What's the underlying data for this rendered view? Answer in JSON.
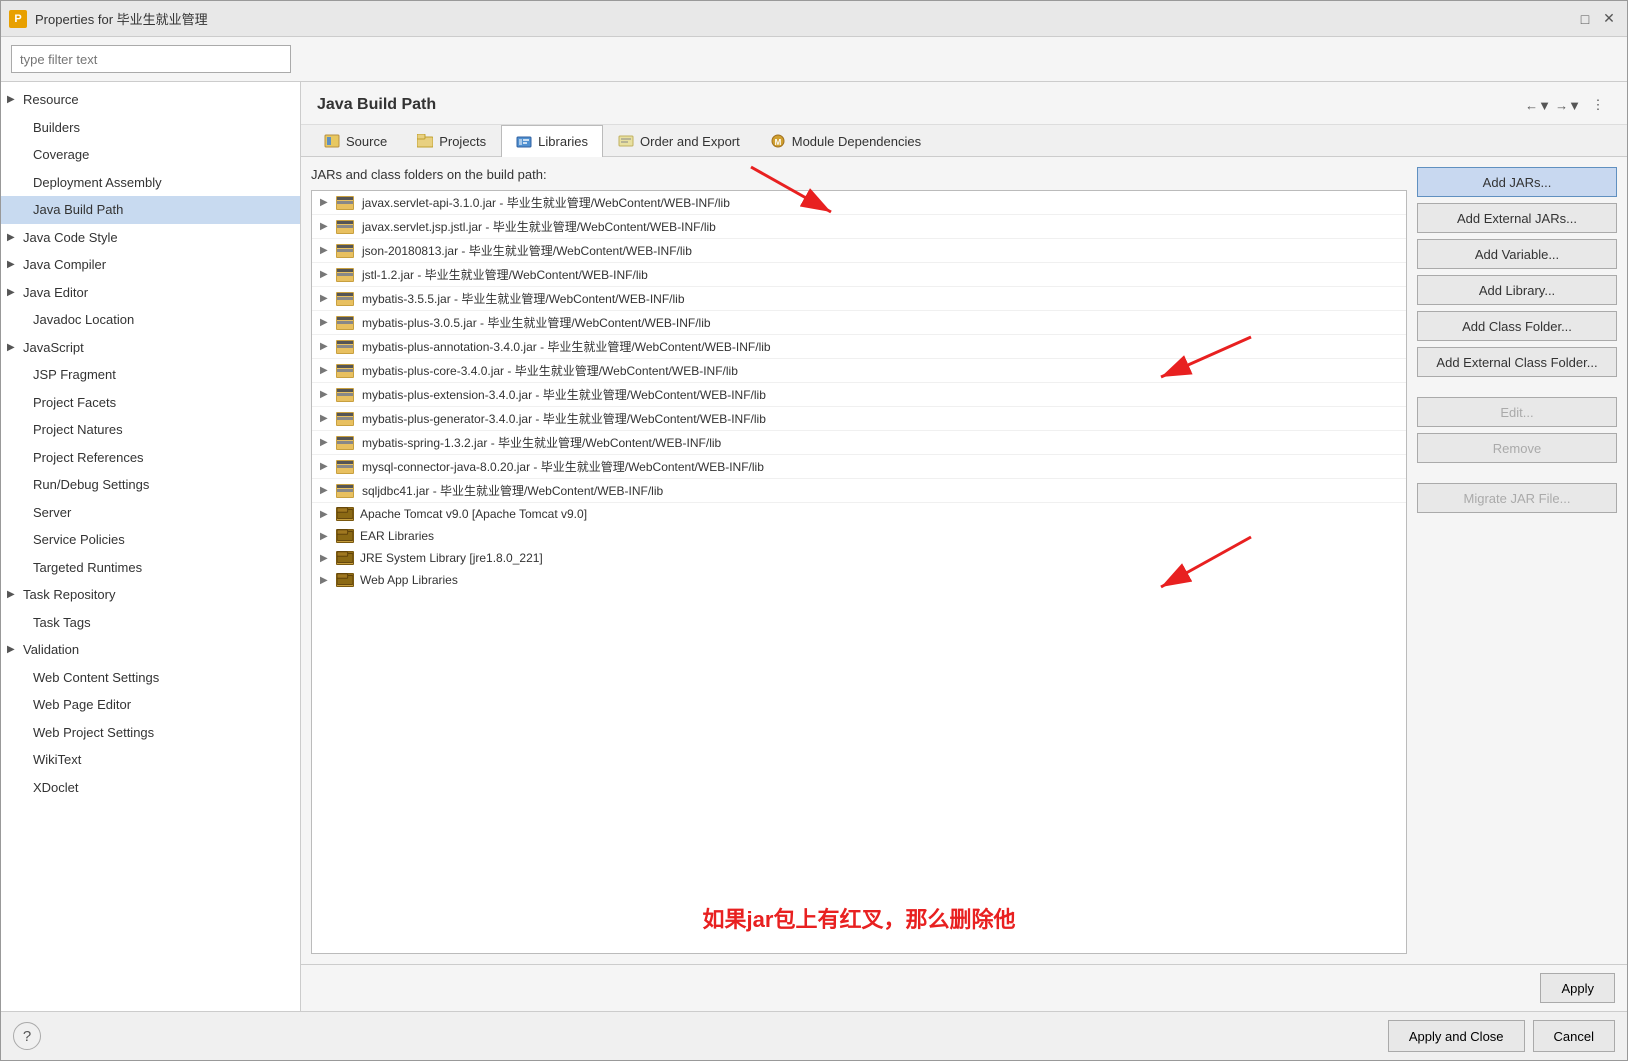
{
  "window": {
    "title": "Properties for 毕业生就业管理",
    "icon": "P"
  },
  "search": {
    "placeholder": "type filter text"
  },
  "sidebar": {
    "items": [
      {
        "label": "Resource",
        "hasArrow": true,
        "selected": false
      },
      {
        "label": "Builders",
        "hasArrow": false,
        "selected": false
      },
      {
        "label": "Coverage",
        "hasArrow": false,
        "selected": false
      },
      {
        "label": "Deployment Assembly",
        "hasArrow": false,
        "selected": false
      },
      {
        "label": "Java Build Path",
        "hasArrow": false,
        "selected": true
      },
      {
        "label": "Java Code Style",
        "hasArrow": true,
        "selected": false
      },
      {
        "label": "Java Compiler",
        "hasArrow": true,
        "selected": false
      },
      {
        "label": "Java Editor",
        "hasArrow": true,
        "selected": false
      },
      {
        "label": "Javadoc Location",
        "hasArrow": false,
        "selected": false
      },
      {
        "label": "JavaScript",
        "hasArrow": true,
        "selected": false
      },
      {
        "label": "JSP Fragment",
        "hasArrow": false,
        "selected": false
      },
      {
        "label": "Project Facets",
        "hasArrow": false,
        "selected": false
      },
      {
        "label": "Project Natures",
        "hasArrow": false,
        "selected": false
      },
      {
        "label": "Project References",
        "hasArrow": false,
        "selected": false
      },
      {
        "label": "Run/Debug Settings",
        "hasArrow": false,
        "selected": false
      },
      {
        "label": "Server",
        "hasArrow": false,
        "selected": false
      },
      {
        "label": "Service Policies",
        "hasArrow": false,
        "selected": false
      },
      {
        "label": "Targeted Runtimes",
        "hasArrow": false,
        "selected": false
      },
      {
        "label": "Task Repository",
        "hasArrow": true,
        "selected": false
      },
      {
        "label": "Task Tags",
        "hasArrow": false,
        "selected": false
      },
      {
        "label": "Validation",
        "hasArrow": true,
        "selected": false
      },
      {
        "label": "Web Content Settings",
        "hasArrow": false,
        "selected": false
      },
      {
        "label": "Web Page Editor",
        "hasArrow": false,
        "selected": false
      },
      {
        "label": "Web Project Settings",
        "hasArrow": false,
        "selected": false
      },
      {
        "label": "WikiText",
        "hasArrow": false,
        "selected": false
      },
      {
        "label": "XDoclet",
        "hasArrow": false,
        "selected": false
      }
    ]
  },
  "panel": {
    "title": "Java Build Path",
    "tabs": [
      {
        "label": "Source",
        "icon": "src",
        "active": false
      },
      {
        "label": "Projects",
        "icon": "proj",
        "active": false
      },
      {
        "label": "Libraries",
        "icon": "lib",
        "active": true
      },
      {
        "label": "Order and Export",
        "icon": "ord",
        "active": false
      },
      {
        "label": "Module Dependencies",
        "icon": "mod",
        "active": false
      }
    ],
    "jars_label": "JARs and class folders on the build path:"
  },
  "jars": [
    {
      "text": "javax.servlet-api-3.1.0.jar - 毕业生就业管理/WebContent/WEB-INF/lib"
    },
    {
      "text": "javax.servlet.jsp.jstl.jar - 毕业生就业管理/WebContent/WEB-INF/lib"
    },
    {
      "text": "json-20180813.jar - 毕业生就业管理/WebContent/WEB-INF/lib"
    },
    {
      "text": "jstl-1.2.jar - 毕业生就业管理/WebContent/WEB-INF/lib"
    },
    {
      "text": "mybatis-3.5.5.jar - 毕业生就业管理/WebContent/WEB-INF/lib"
    },
    {
      "text": "mybatis-plus-3.0.5.jar - 毕业生就业管理/WebContent/WEB-INF/lib"
    },
    {
      "text": "mybatis-plus-annotation-3.4.0.jar - 毕业生就业管理/WebContent/WEB-INF/lib"
    },
    {
      "text": "mybatis-plus-core-3.4.0.jar - 毕业生就业管理/WebContent/WEB-INF/lib"
    },
    {
      "text": "mybatis-plus-extension-3.4.0.jar - 毕业生就业管理/WebContent/WEB-INF/lib"
    },
    {
      "text": "mybatis-plus-generator-3.4.0.jar - 毕业生就业管理/WebContent/WEB-INF/lib"
    },
    {
      "text": "mybatis-spring-1.3.2.jar - 毕业生就业管理/WebContent/WEB-INF/lib"
    },
    {
      "text": "mysql-connector-java-8.0.20.jar - 毕业生就业管理/WebContent/WEB-INF/lib"
    },
    {
      "text": "sqljdbc41.jar - 毕业生就业管理/WebContent/WEB-INF/lib"
    }
  ],
  "libraries": [
    {
      "text": "Apache Tomcat v9.0 [Apache Tomcat v9.0]"
    },
    {
      "text": "EAR Libraries"
    },
    {
      "text": "JRE System Library [jre1.8.0_221]"
    },
    {
      "text": "Web App Libraries"
    }
  ],
  "buttons": {
    "add_jars": "Add JARs...",
    "add_external_jars": "Add External JARs...",
    "add_variable": "Add Variable...",
    "add_library": "Add Library...",
    "add_class_folder": "Add Class Folder...",
    "add_external_class_folder": "Add External Class Folder...",
    "edit": "Edit...",
    "remove": "Remove",
    "migrate_jar": "Migrate JAR File..."
  },
  "footer": {
    "apply": "Apply",
    "apply_close": "Apply and Close",
    "cancel": "Cancel",
    "help": "?"
  },
  "annotation": {
    "text": "如果jar包上有红叉，那么删除他"
  }
}
